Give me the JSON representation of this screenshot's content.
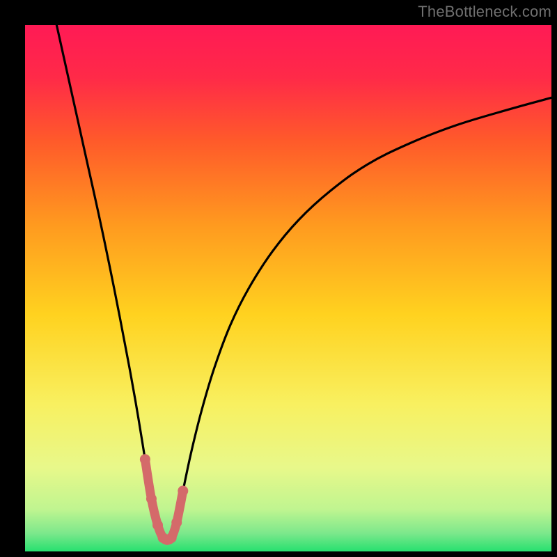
{
  "watermark": "TheBottleneck.com",
  "palette": {
    "frame": "#000000",
    "gradient_stops": [
      {
        "offset": 0.0,
        "color": "#ff1a55"
      },
      {
        "offset": 0.1,
        "color": "#ff2a48"
      },
      {
        "offset": 0.22,
        "color": "#ff5a2a"
      },
      {
        "offset": 0.38,
        "color": "#ff9a1f"
      },
      {
        "offset": 0.55,
        "color": "#ffd21f"
      },
      {
        "offset": 0.72,
        "color": "#f8f060"
      },
      {
        "offset": 0.84,
        "color": "#e8f88a"
      },
      {
        "offset": 0.92,
        "color": "#c0f590"
      },
      {
        "offset": 0.965,
        "color": "#7de88c"
      },
      {
        "offset": 1.0,
        "color": "#27e06f"
      }
    ],
    "curve_stroke": "#000000",
    "accent_stroke": "#d46a6a"
  },
  "chart_data": {
    "type": "line",
    "title": "",
    "xlabel": "",
    "ylabel": "",
    "xlim": [
      0,
      1
    ],
    "ylim": [
      0,
      1
    ],
    "grid": false,
    "legend": false,
    "series": [
      {
        "name": "bottleneck-curve",
        "x": [
          0.06,
          0.08,
          0.1,
          0.12,
          0.14,
          0.16,
          0.18,
          0.2,
          0.215,
          0.228,
          0.24,
          0.252,
          0.262,
          0.27,
          0.278,
          0.288,
          0.3,
          0.316,
          0.336,
          0.36,
          0.39,
          0.425,
          0.47,
          0.52,
          0.58,
          0.65,
          0.73,
          0.82,
          0.92,
          1.0
        ],
        "y": [
          1.0,
          0.91,
          0.82,
          0.73,
          0.64,
          0.545,
          0.445,
          0.34,
          0.255,
          0.175,
          0.1,
          0.05,
          0.026,
          0.022,
          0.026,
          0.055,
          0.115,
          0.19,
          0.27,
          0.35,
          0.43,
          0.5,
          0.57,
          0.63,
          0.685,
          0.735,
          0.775,
          0.81,
          0.84,
          0.862
        ]
      },
      {
        "name": "green-zone-accent",
        "x": [
          0.228,
          0.24,
          0.252,
          0.262,
          0.27,
          0.278,
          0.288,
          0.3
        ],
        "y": [
          0.175,
          0.1,
          0.05,
          0.026,
          0.022,
          0.026,
          0.055,
          0.115
        ]
      }
    ],
    "min_point": {
      "x": 0.27,
      "y": 0.022
    }
  }
}
